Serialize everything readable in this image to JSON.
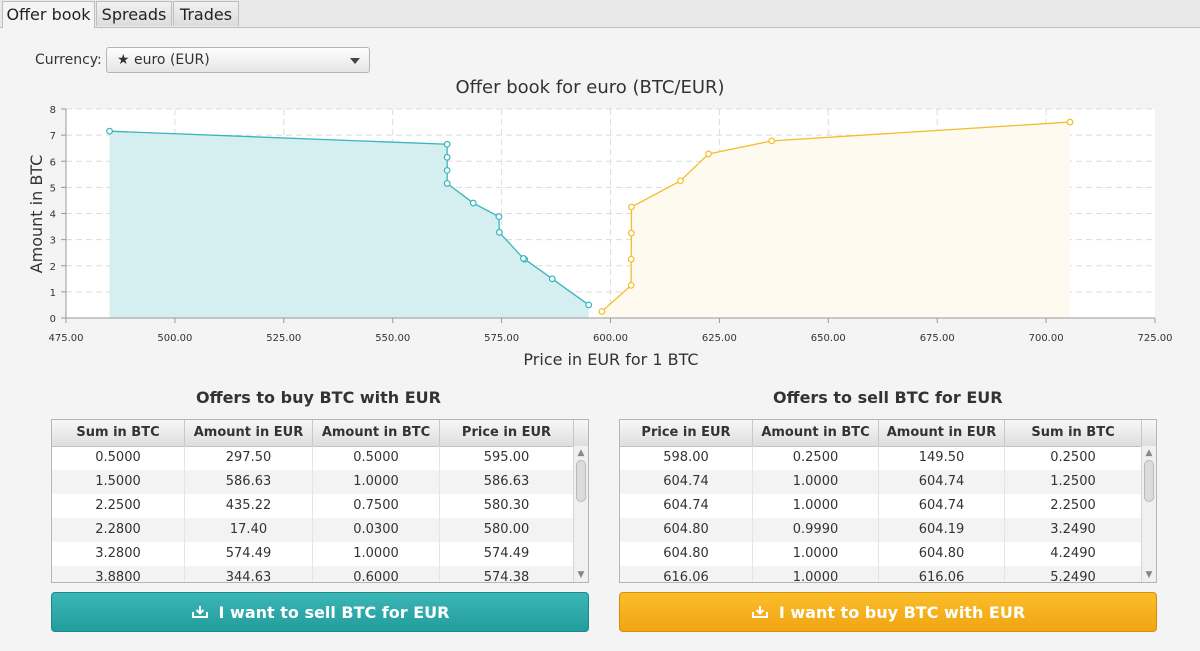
{
  "tabs": [
    {
      "label": "Offer book",
      "active": true
    },
    {
      "label": "Spreads",
      "active": false
    },
    {
      "label": "Trades",
      "active": false
    }
  ],
  "currency": {
    "label": "Currency:",
    "selected": "★ euro (EUR)"
  },
  "chart_data": {
    "type": "area",
    "title": "Offer book for euro (BTC/EUR)",
    "xlabel": "Price in EUR for 1 BTC",
    "ylabel": "Amount in BTC",
    "xlim": [
      475,
      725
    ],
    "ylim": [
      0,
      8
    ],
    "x_ticks": [
      "475.00",
      "500.00",
      "525.00",
      "550.00",
      "575.00",
      "600.00",
      "625.00",
      "650.00",
      "675.00",
      "700.00",
      "725.00"
    ],
    "y_ticks": [
      "0",
      "1",
      "2",
      "3",
      "4",
      "5",
      "6",
      "7",
      "8"
    ],
    "grid": true,
    "series": [
      {
        "color": "#3ab5bd",
        "fill": "#d5eff0",
        "points": [
          [
            595,
            0.5
          ],
          [
            586.63,
            1.5
          ],
          [
            580.3,
            2.25
          ],
          [
            580,
            2.28
          ],
          [
            574.49,
            3.28
          ],
          [
            574.38,
            3.88
          ],
          [
            568.5,
            4.4
          ],
          [
            562.5,
            5.15
          ],
          [
            562.5,
            5.65
          ],
          [
            562.5,
            6.15
          ],
          [
            562.5,
            6.65
          ],
          [
            485,
            7.15
          ]
        ]
      },
      {
        "color": "#f2bd2d",
        "fill": "#fefaf0",
        "points": [
          [
            598,
            0.25
          ],
          [
            604.74,
            1.25
          ],
          [
            604.74,
            2.25
          ],
          [
            604.8,
            3.249
          ],
          [
            604.8,
            4.249
          ],
          [
            616.06,
            5.249
          ],
          [
            622.5,
            6.28
          ],
          [
            637,
            6.78
          ],
          [
            705.5,
            7.5
          ]
        ]
      }
    ]
  },
  "buy_offers": {
    "title": "Offers to buy BTC with EUR",
    "columns": [
      "Sum in BTC",
      "Amount in EUR",
      "Amount in BTC",
      "Price in EUR"
    ],
    "rows": [
      [
        "0.5000",
        "297.50",
        "0.5000",
        "595.00"
      ],
      [
        "1.5000",
        "586.63",
        "1.0000",
        "586.63"
      ],
      [
        "2.2500",
        "435.22",
        "0.7500",
        "580.30"
      ],
      [
        "2.2800",
        "17.40",
        "0.0300",
        "580.00"
      ],
      [
        "3.2800",
        "574.49",
        "1.0000",
        "574.49"
      ],
      [
        "3.8800",
        "344.63",
        "0.6000",
        "574.38"
      ]
    ]
  },
  "sell_offers": {
    "title": "Offers to sell BTC for EUR",
    "columns": [
      "Price in EUR",
      "Amount in BTC",
      "Amount in EUR",
      "Sum in BTC"
    ],
    "rows": [
      [
        "598.00",
        "0.2500",
        "149.50",
        "0.2500"
      ],
      [
        "604.74",
        "1.0000",
        "604.74",
        "1.2500"
      ],
      [
        "604.74",
        "1.0000",
        "604.74",
        "2.2500"
      ],
      [
        "604.80",
        "0.9990",
        "604.19",
        "3.2490"
      ],
      [
        "604.80",
        "1.0000",
        "604.80",
        "4.2490"
      ],
      [
        "616.06",
        "1.0000",
        "616.06",
        "5.2490"
      ]
    ]
  },
  "actions": {
    "sell_label": "I want to sell BTC for EUR",
    "buy_label": "I want to buy BTC with EUR",
    "icon": "download-tray-icon"
  }
}
